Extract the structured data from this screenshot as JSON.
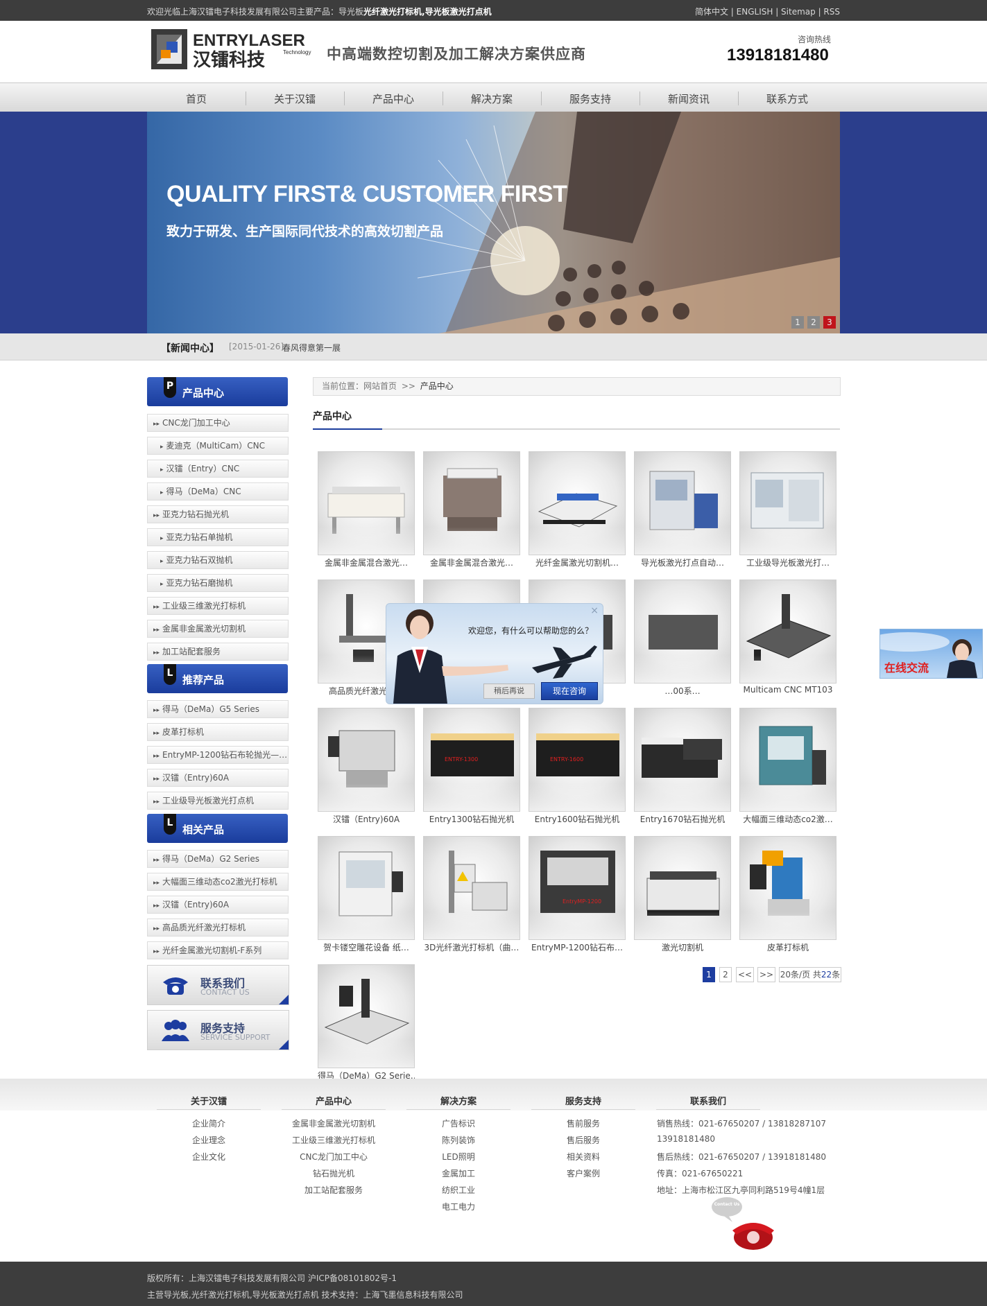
{
  "topbar": {
    "welcome_prefix": "欢迎光临上海汉镭电子科技发展有限公司主要产品：导光板",
    "welcome_bold": "光纤激光打标机,导光板激光打点机",
    "links": "简体中文 | ENGLISH | Sitemap | RSS"
  },
  "header": {
    "logo_en": "ENTRYLASER",
    "logo_cn": "汉镭科技",
    "logo_tech": "Technology",
    "slogan": "中高端数控切割及加工解决方案供应商",
    "hotline_label": "咨询热线",
    "hotline": "13918181480"
  },
  "nav": [
    "首页",
    "关于汉镭",
    "产品中心",
    "解决方案",
    "服务支持",
    "新闻资讯",
    "联系方式"
  ],
  "banner": {
    "title": "QUALITY FIRST& CUSTOMER FIRST",
    "subtitle": "致力于研发、生产国际同代技术的高效切割产品",
    "dots": [
      "1",
      "2",
      "3"
    ],
    "active_dot": "3"
  },
  "newsbar": {
    "label": "【新闻中心】",
    "date": "[2015-01-26]",
    "headline": "春风得意第一展"
  },
  "sidebar": {
    "products": {
      "badge": "P",
      "title": "产品中心",
      "items": [
        {
          "label": "CNC龙门加工中心",
          "sub": false
        },
        {
          "label": "麦迪克（MultiCam）CNC",
          "sub": true
        },
        {
          "label": "汉镭（Entry）CNC",
          "sub": true
        },
        {
          "label": "得马（DeMa）CNC",
          "sub": true
        },
        {
          "label": "亚克力钻石抛光机",
          "sub": false
        },
        {
          "label": "亚克力钻石单抛机",
          "sub": true
        },
        {
          "label": "亚克力钻石双抛机",
          "sub": true
        },
        {
          "label": "亚克力钻石磨抛机",
          "sub": true
        },
        {
          "label": "工业级三维激光打标机",
          "sub": false
        },
        {
          "label": "金属非金属激光切割机",
          "sub": false
        },
        {
          "label": "加工站配套服务",
          "sub": false
        }
      ]
    },
    "recommended": {
      "badge": "L",
      "title": "推荐产品",
      "items": [
        "得马（DeMa）G5 Series",
        "皮革打标机",
        "EntryMP-1200钻石布轮抛光—…",
        "汉镭（Entry)60A",
        "工业级导光板激光打点机"
      ]
    },
    "related": {
      "badge": "L",
      "title": "相关产品",
      "items": [
        "得马（DeMa）G2 Series",
        "大幅面三维动态co2激光打标机",
        "汉镭（Entry)60A",
        "高品质光纤激光打标机",
        "光纤金属激光切割机-F系列"
      ]
    },
    "contact_box": {
      "cn": "联系我们",
      "en": "CONTACT US"
    },
    "service_box": {
      "cn": "服务支持",
      "en": "SERVICE SUPPORT"
    }
  },
  "main": {
    "breadcrumb_prefix": "当前位置：",
    "breadcrumb_home": "网站首页",
    "breadcrumb_sep": ">>",
    "breadcrumb_current": "产品中心",
    "section_title": "产品中心",
    "products": [
      "金属非金属混合激光…",
      "金属非金属混合激光…",
      "光纤金属激光切割机…",
      "导光板激光打点自动…",
      "工业级导光板激光打…",
      "高品质光纤激光打…",
      "",
      "",
      "…00系…",
      "Multicam CNC MT103",
      "汉镭（Entry)60A",
      "Entry1300钻石抛光机",
      "Entry1600钻石抛光机",
      "Entry1670钻石抛光机",
      "大幅面三维动态co2激…",
      "贺卡镂空雕花设备 纸…",
      "3D光纤激光打标机（曲…",
      "EntryMP-1200钻石布…",
      "激光切割机",
      "皮革打标机",
      "得马（DeMa）G2 Serie…"
    ],
    "pager": {
      "pages": [
        "1",
        "2"
      ],
      "current": "1",
      "prev": "<<",
      "next": ">>",
      "per_page_prefix": "20条/页 共",
      "total": "22",
      "total_suffix": "条"
    }
  },
  "popup": {
    "message": "欢迎您，有什么可以帮助您的么？",
    "later": "稍后再说",
    "now": "现在咨询",
    "close": "×"
  },
  "chat_float": {
    "label": "在线交流"
  },
  "footer": {
    "columns": [
      {
        "title": "关于汉镭",
        "links": [
          "企业简介",
          "企业理念",
          "企业文化"
        ]
      },
      {
        "title": "产品中心",
        "links": [
          "金属非金属激光切割机",
          "工业级三维激光打标机",
          "CNC龙门加工中心",
          "钻石抛光机",
          "加工站配套服务"
        ]
      },
      {
        "title": "解决方案",
        "links": [
          "广告标识",
          "陈列装饰",
          "LED照明",
          "金属加工",
          "纺织工业",
          "电工电力"
        ]
      },
      {
        "title": "服务支持",
        "links": [
          "售前服务",
          "售后服务",
          "相关资料",
          "客户案例"
        ]
      },
      {
        "title": "联系我们",
        "links": [
          "销售热线：021-67650207 / 13818287107",
          "13918181480",
          "售后热线：021-67650207 / 13918181480",
          "传真：021-67650221",
          "地址：上海市松江区九亭同利路519号4幢1层"
        ]
      }
    ],
    "phone_bubble": "Contact Us",
    "copyright": "版权所有：上海汉镭电子科技发展有限公司  沪ICP备08101802号-1",
    "copyright2": "主营导光板,光纤激光打标机,导光板激光打点机  技术支持：上海飞墨信息科技有限公司"
  },
  "colors": {
    "primary_blue": "#1d3da0",
    "topbar_bg": "#3d3d3d",
    "banner_bg": "#2b3e8c",
    "dot_active": "#c0141b"
  }
}
